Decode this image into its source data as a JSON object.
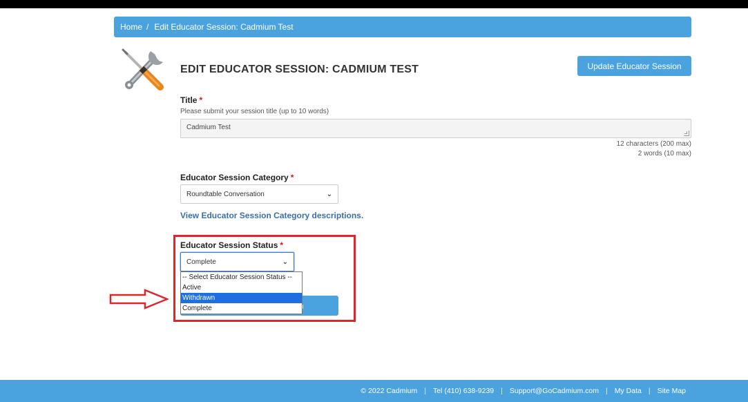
{
  "breadcrumb": {
    "home": "Home",
    "separator": "/",
    "current": "Edit Educator Session: Cadmium Test"
  },
  "page": {
    "title": "EDIT EDUCATOR SESSION: CADMIUM TEST",
    "update_button": "Update Educator Session"
  },
  "title_field": {
    "label": "Title",
    "required_mark": "*",
    "help": "Please submit your session title (up to 10 words)",
    "value": "Cadmium Test",
    "char_count": "12 characters (200 max)",
    "word_count": "2 words (10 max)"
  },
  "category_field": {
    "label": "Educator Session Category",
    "required_mark": "*",
    "selected": "Roundtable Conversation",
    "link": "View Educator Session Category descriptions."
  },
  "status_field": {
    "label": "Educator Session Status",
    "required_mark": "*",
    "selected": "Complete",
    "options": [
      "-- Select Educator Session Status --",
      "Active",
      "Withdrawn",
      "Complete"
    ],
    "highlighted_option": "Withdrawn"
  },
  "hidden_button": {
    "visible_fragment": "n"
  },
  "footer": {
    "copyright": "© 2022 Cadmium",
    "tel": "Tel (410) 638-9239",
    "email": "Support@GoCadmium.com",
    "my_data": "My Data",
    "site_map": "Site Map",
    "separator": "|"
  },
  "icons": {
    "tools": "wrench-screwdriver-icon",
    "dropdown": "chevron-down-icon",
    "annotation": "red-arrow-icon"
  },
  "colors": {
    "accent": "#4aa3df",
    "required": "#d01616",
    "annotation": "#e0242b",
    "option_highlight": "#1e6fe0"
  }
}
